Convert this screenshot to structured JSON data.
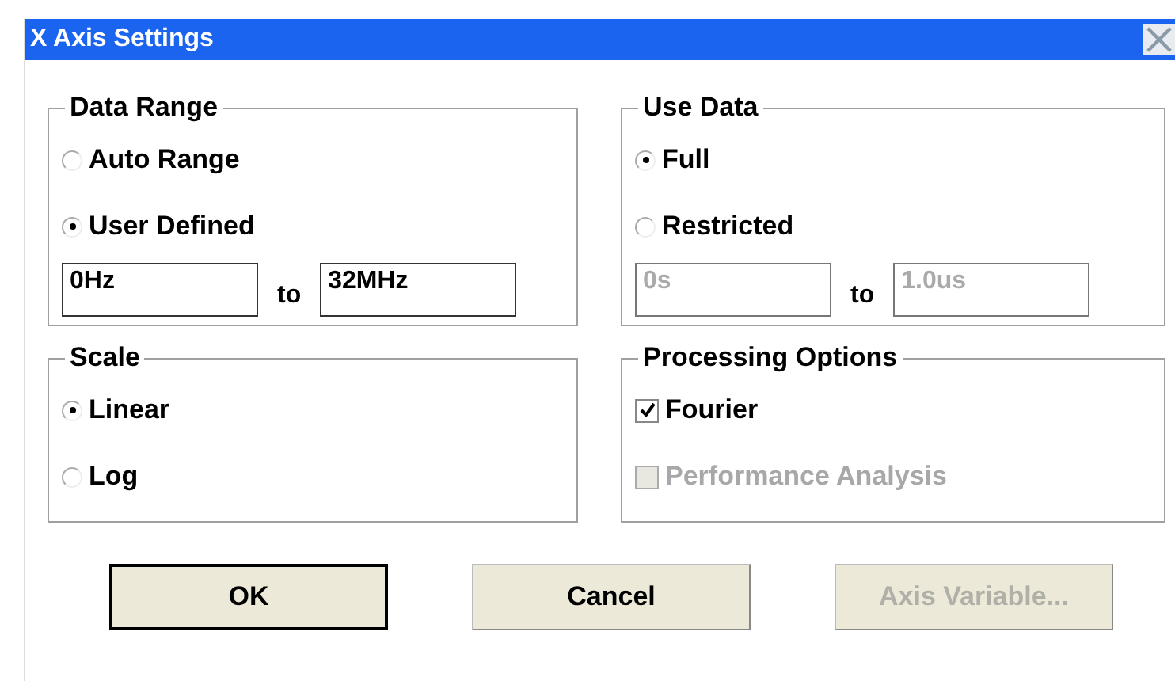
{
  "window": {
    "title": "X Axis Settings"
  },
  "groups": [
    {
      "kind": "radio",
      "title": "Data Range",
      "options": [
        {
          "label": "Auto Range",
          "selected": false
        },
        {
          "label": "User Defined",
          "selected": true
        }
      ],
      "range": {
        "from": "0Hz",
        "to_label": "to",
        "to": "32MHz",
        "disabled": false
      }
    },
    {
      "kind": "radio",
      "title": "Use Data",
      "options": [
        {
          "label": "Full",
          "selected": true
        },
        {
          "label": "Restricted",
          "selected": false
        }
      ],
      "range": {
        "from": "0s",
        "to_label": "to",
        "to": "1.0us",
        "disabled": true
      }
    },
    {
      "kind": "radio",
      "title": "Scale",
      "options": [
        {
          "label": "Linear",
          "selected": true
        },
        {
          "label": "Log",
          "selected": false
        }
      ]
    },
    {
      "kind": "check",
      "title": "Processing Options",
      "options": [
        {
          "label": "Fourier",
          "checked": true,
          "disabled": false
        },
        {
          "label": "Performance Analysis",
          "checked": false,
          "disabled": true
        }
      ]
    }
  ],
  "buttons": [
    {
      "label": "OK",
      "default": true,
      "disabled": false
    },
    {
      "label": "Cancel",
      "default": false,
      "disabled": false
    },
    {
      "label": "Axis Variable...",
      "default": false,
      "disabled": true
    }
  ]
}
